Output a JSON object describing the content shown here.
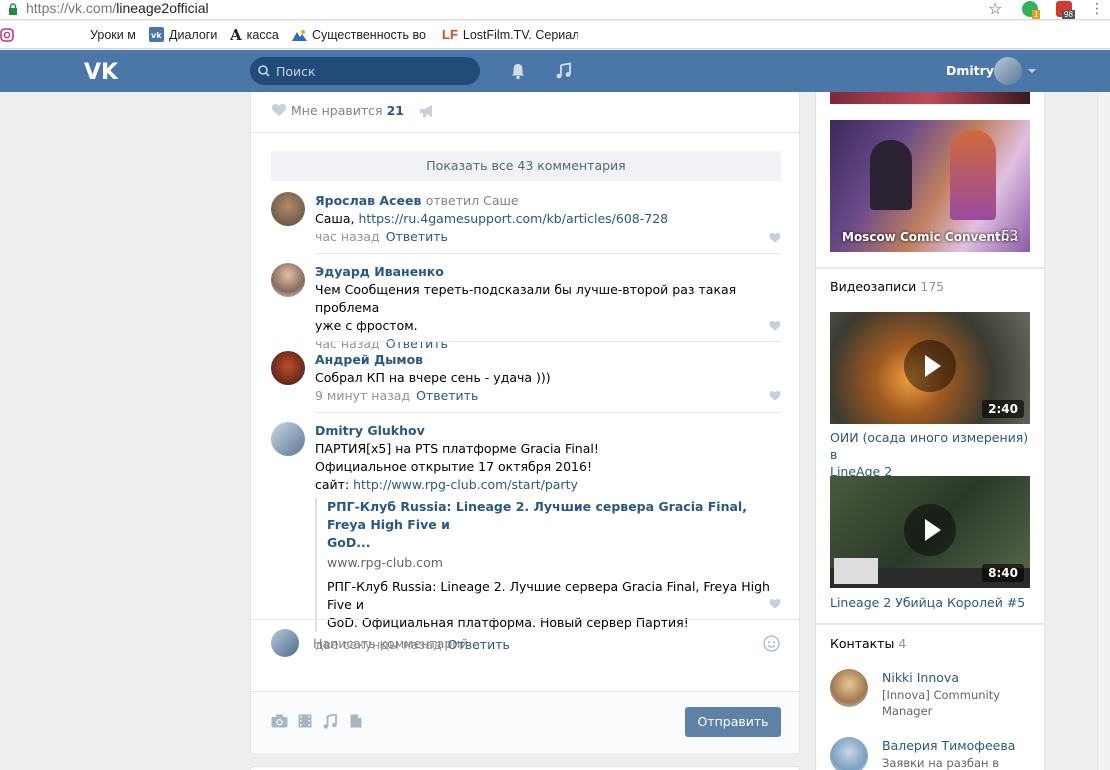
{
  "browser": {
    "url_domain": "https://vk.com/",
    "url_path": "lineage2official",
    "ext_badge_1": "1",
    "ext_badge_2": "98"
  },
  "bookmarks": [
    {
      "label": "Уроки м"
    },
    {
      "label": "Диалоги"
    },
    {
      "label": "касса"
    },
    {
      "label": "Существенность во в"
    },
    {
      "label": "LostFilm.TV. Сериалы"
    }
  ],
  "header": {
    "search_placeholder": "Поиск",
    "user_name": "Dmitry"
  },
  "post": {
    "like_label": "Мне нравится",
    "like_count": "21",
    "show_all": "Показать все 43 комментария"
  },
  "comments": [
    {
      "author": "Ярослав Асеев",
      "replied": "ответил Саше",
      "text_prefix": "Саша, ",
      "link": "https://ru.4gamesupport.com/kb/articles/608-728",
      "time": "час назад",
      "reply": "Ответить"
    },
    {
      "author": "Эдуард Иваненко",
      "text_1": "Чем Сообщения тереть-подсказали бы лучше-второй раз такая проблема",
      "text_2": "уже с фростом.",
      "time": "час назад",
      "reply": "Ответить"
    },
    {
      "author": "Андрей Дымов",
      "text": "Собрал КП на вчере сень - удача )))",
      "time": "9 минут назад",
      "reply": "Ответить"
    },
    {
      "author": "Dmitry Glukhov",
      "text_1": "ПАРТИЯ[x5] на PTS платформе Gracia Final!",
      "text_2": "Официальное открытие 17 октября 2016!",
      "site_label": "сайт: ",
      "site_link": "http://www.rpg-club.com/start/party",
      "snippet_title_1": "РПГ-Клуб Russia: Lineage 2. Лучшие сервера Gracia Final, Freya High Five и",
      "snippet_title_2": "GoD...",
      "snippet_domain": "www.rpg-club.com",
      "snippet_desc_1": "РПГ-Клуб Russia: Lineage 2. Лучшие сервера Gracia Final, Freya High Five и",
      "snippet_desc_2": "GoD. Официальная платформа. Новый сервер Партия!",
      "time": "две секунды назад",
      "reply": "Ответить"
    }
  ],
  "compose": {
    "placeholder": "Написать комментарий...",
    "send": "Отправить"
  },
  "sidebar": {
    "album": {
      "label": "Moscow Comic Conventi...",
      "count": "53"
    },
    "videos": {
      "title": "Видеозаписи",
      "count": "175",
      "items": [
        {
          "duration": "2:40",
          "title_1": "ОИИ (осада иного измерения) в",
          "title_2": "LineAge 2"
        },
        {
          "duration": "8:40",
          "title_1": "Lineage 2 Убийца Королей #5",
          "title_2": ""
        }
      ]
    },
    "contacts": {
      "title": "Контакты",
      "count": "4",
      "items": [
        {
          "name": "Nikki Innova",
          "role_1": "[Innova] Community",
          "role_2": "Manager"
        },
        {
          "name": "Валерия Тимофеева",
          "role_1": "Заявки на разбан в",
          "role_2": ""
        }
      ]
    }
  },
  "colors": {
    "vk_blue": "#4a76a8",
    "link": "#2a5885",
    "send_button": "#5e81a8"
  }
}
